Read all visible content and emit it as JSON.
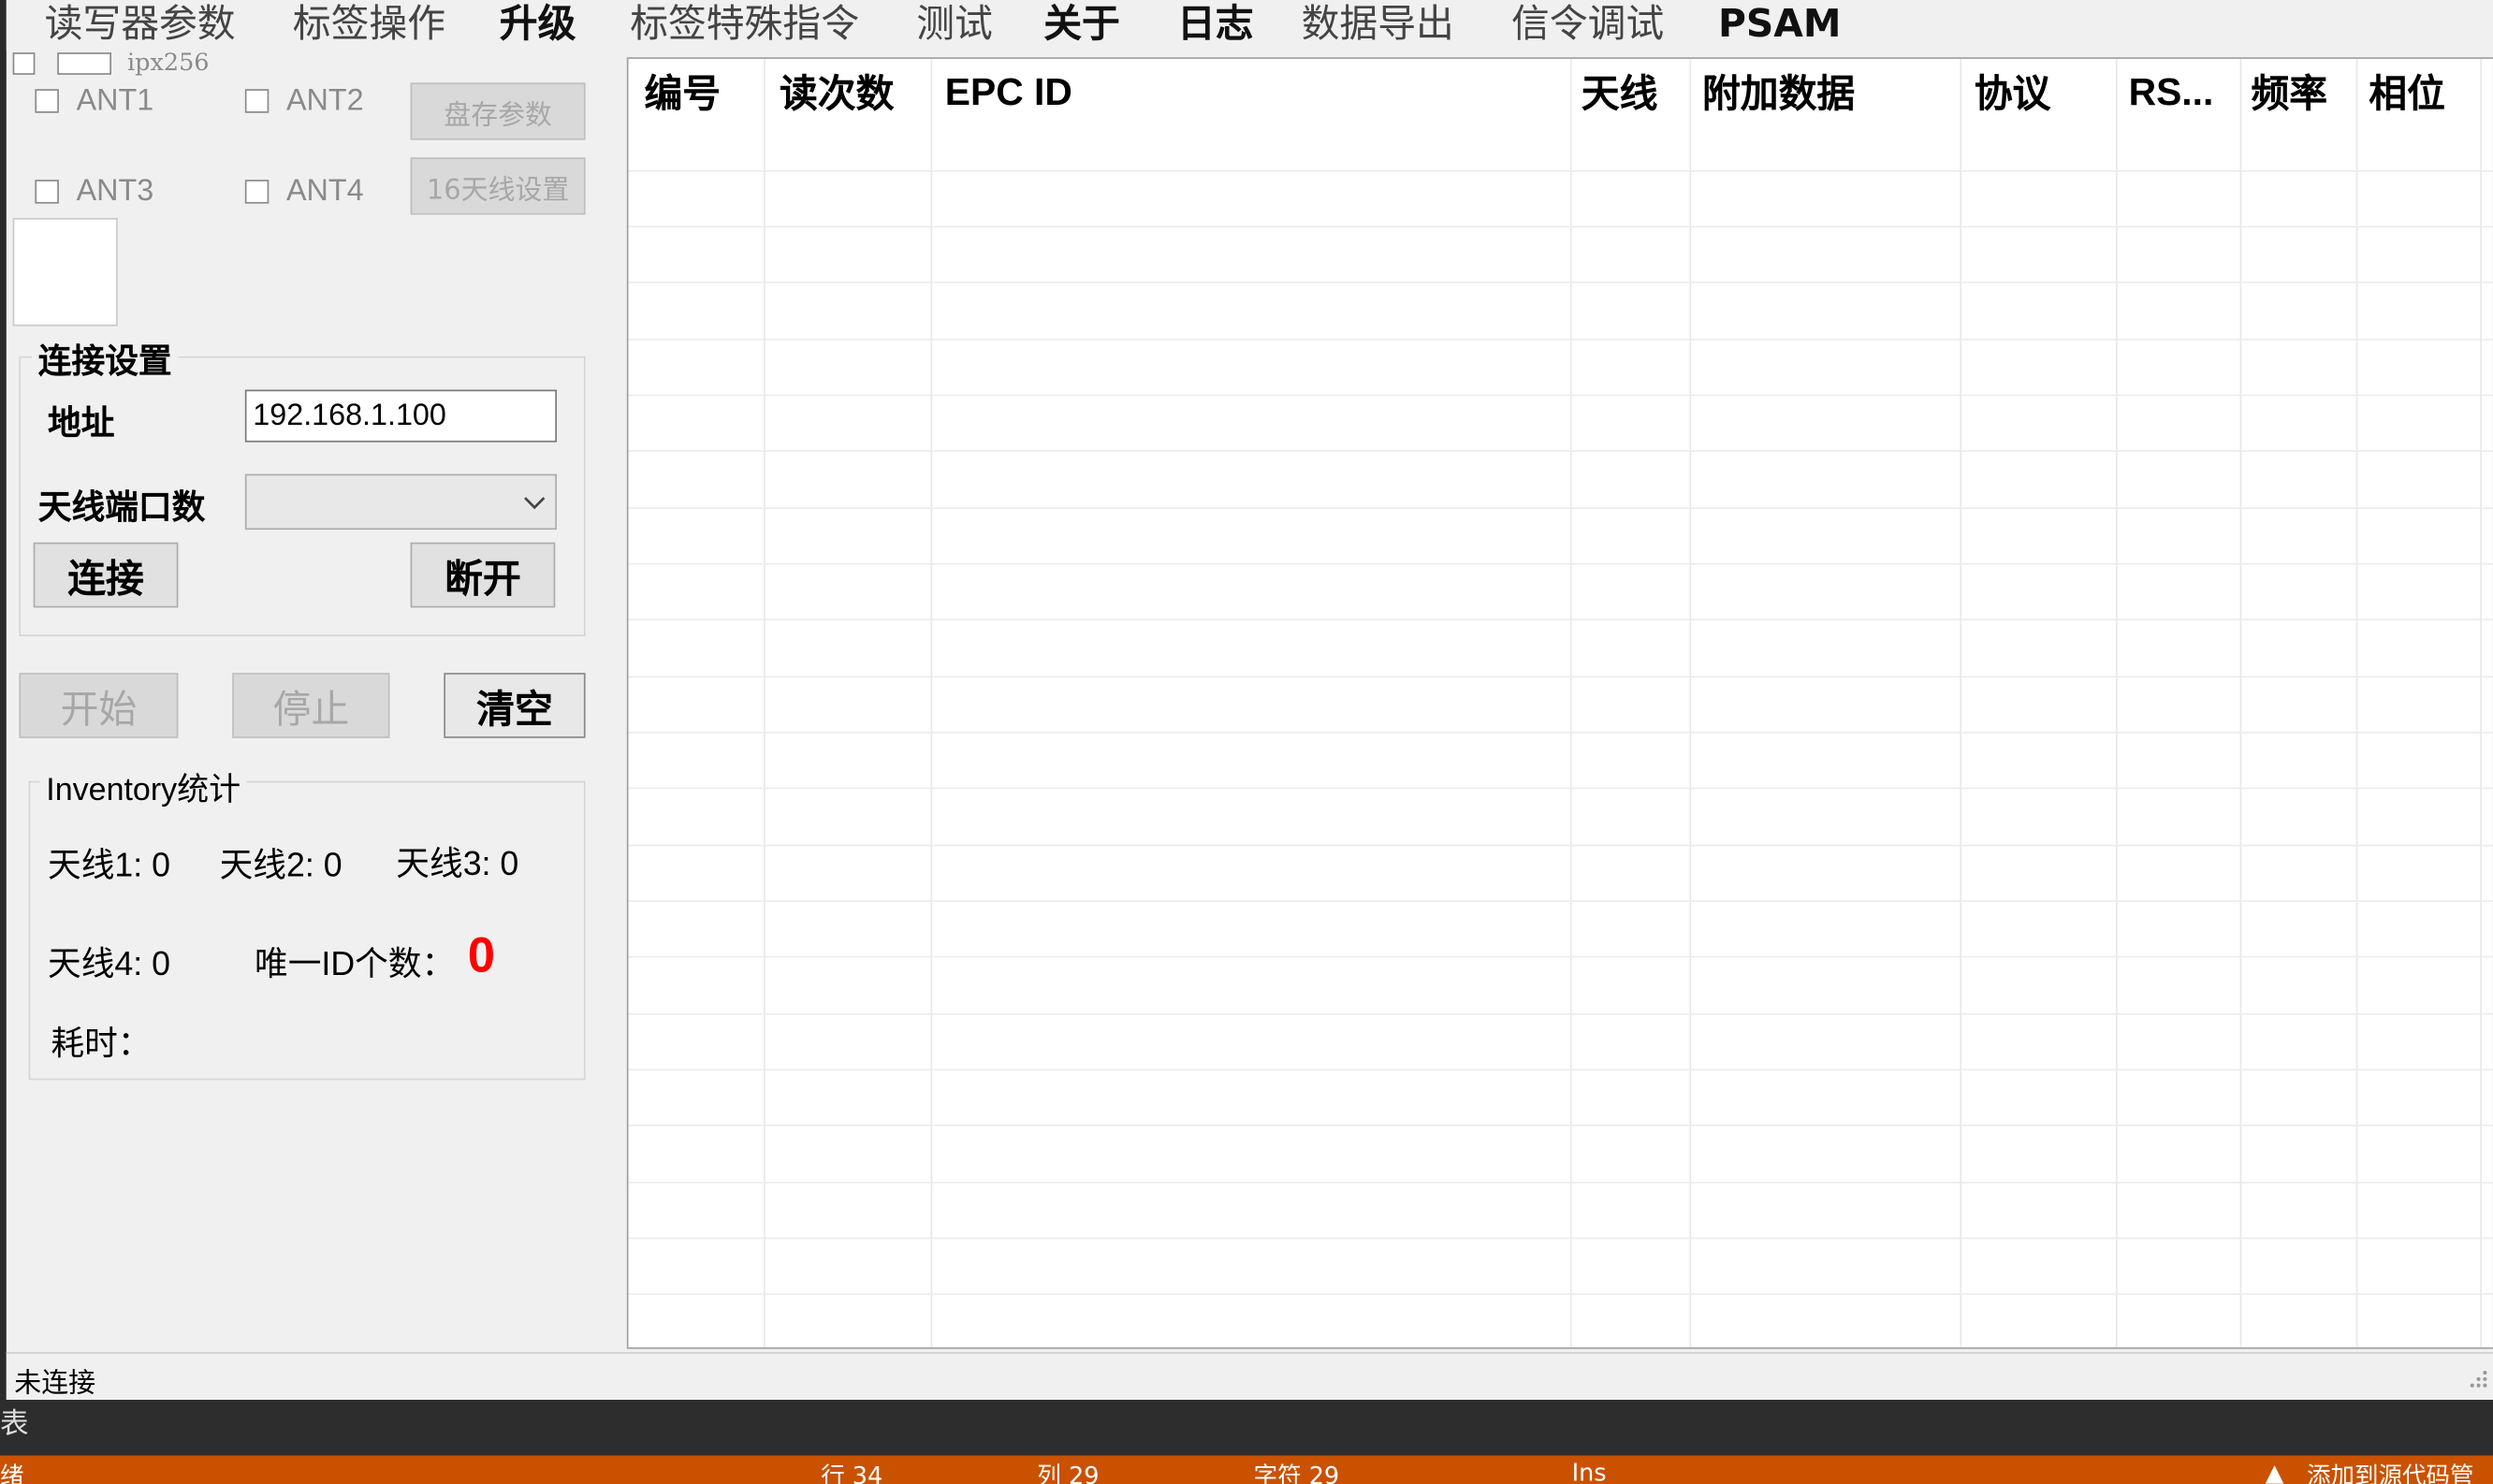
{
  "menu": {
    "items": [
      {
        "label": "读写器参数"
      },
      {
        "label": "标签操作"
      },
      {
        "label": "升级"
      },
      {
        "label": "标签特殊指令"
      },
      {
        "label": "测试"
      },
      {
        "label": "关于"
      },
      {
        "label": "日志"
      },
      {
        "label": "数据导出"
      },
      {
        "label": "信令调试"
      },
      {
        "label": "PSAM"
      }
    ]
  },
  "top_panel": {
    "ipx_label": "ipx256",
    "ant1": "ANT1",
    "ant2": "ANT2",
    "ant3": "ANT3",
    "ant4": "ANT4",
    "save_params": "盘存参数",
    "ant16_settings": "16天线设置"
  },
  "connection": {
    "title": "连接设置",
    "address_label": "地址",
    "address_value": "192.168.1.100",
    "antenna_ports_label": "天线端口数",
    "antenna_ports_value": "",
    "connect": "连接",
    "disconnect": "断开"
  },
  "actions": {
    "start": "开始",
    "stop": "停止",
    "clear": "清空"
  },
  "inventory": {
    "title": "Inventory统计",
    "ant1": "天线1:  0",
    "ant2": "天线2:  0",
    "ant3": "天线3: 0",
    "ant4": "天线4:   0",
    "unique_label": "唯一ID个数：",
    "unique_value": "0",
    "time_label": "耗时："
  },
  "table": {
    "columns": [
      "编号",
      "读次数",
      "EPC ID",
      "天线",
      "附加数据",
      "协议",
      "RS...",
      "频率",
      "相位"
    ]
  },
  "status": {
    "text": "未连接"
  },
  "bottom": {
    "dark_text": "表",
    "orange_left": "绪",
    "line": "行 34",
    "col": "列 29",
    "chars": "字符 29",
    "ins": "Ins",
    "add_source": "添加到源代码管"
  },
  "colors": {
    "accent_red": "#ff0000",
    "orange_bar": "#ca5100",
    "dark_bar": "#2d2d2d"
  }
}
